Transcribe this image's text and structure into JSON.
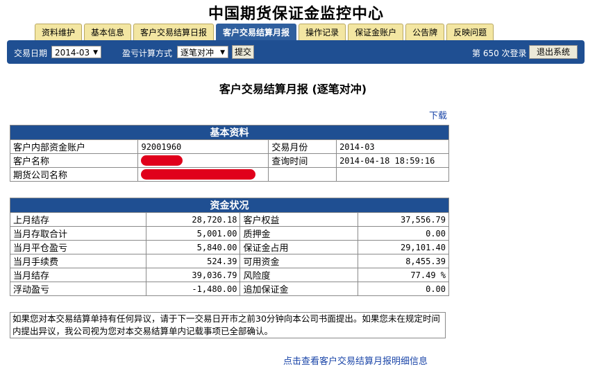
{
  "site_title": "中国期货保证金监控中心",
  "tabs": [
    "资料维护",
    "基本信息",
    "客户交易结算日报",
    "客户交易结算月报",
    "操作记录",
    "保证金账户",
    "公告牌",
    "反映问题"
  ],
  "active_tab": 3,
  "toolbar": {
    "trade_date_label": "交易日期",
    "trade_date_value": "2014-03",
    "calc_method_label": "盈亏计算方式",
    "calc_method_value": "逐笔对冲",
    "submit_label": "提交",
    "login_count": "第 650 次登录",
    "logout_label": "退出系统"
  },
  "page_heading": "客户交易结算月报 (逐笔对冲)",
  "download_label": "下载",
  "basic_info": {
    "header": "基本资料",
    "account_label": "客户内部资金账户",
    "account_value": "92001960",
    "month_label": "交易月份",
    "month_value": "2014-03",
    "name_label": "客户名称",
    "query_time_label": "查询时间",
    "query_time_value": "2014-04-18 18:59:16",
    "company_label": "期货公司名称"
  },
  "funds": {
    "header": "资金状况",
    "rows": [
      {
        "l1": "上月结存",
        "v1": "28,720.18",
        "l2": "客户权益",
        "v2": "37,556.79"
      },
      {
        "l1": "当月存取合计",
        "v1": "5,001.00",
        "l2": "质押金",
        "v2": "0.00"
      },
      {
        "l1": "当月平仓盈亏",
        "v1": "5,840.00",
        "l2": "保证金占用",
        "v2": "29,101.40"
      },
      {
        "l1": "当月手续费",
        "v1": "524.39",
        "l2": "可用资金",
        "v2": "8,455.39"
      },
      {
        "l1": "当月结存",
        "v1": "39,036.79",
        "l2": "风险度",
        "v2": "77.49 %"
      },
      {
        "l1": "浮动盈亏",
        "v1": "-1,480.00",
        "l2": "追加保证金",
        "v2": "0.00"
      }
    ]
  },
  "notice": "如果您对本交易结算单持有任何异议，请于下一交易日开市之前30分钟向本公司书面提出。如果您未在规定时间内提出异议，我公司视为您对本交易结算单内记载事项已全部确认。",
  "detail_link": "点击查看客户交易结算月报明细信息"
}
